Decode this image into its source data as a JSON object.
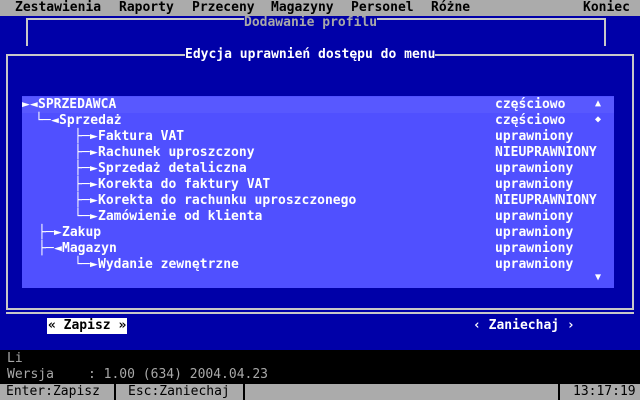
{
  "menubar": {
    "items": [
      "Zestawienia",
      "Raporty",
      "Przeceny",
      "Magazyny",
      "Personel",
      "Różne"
    ],
    "exit_label": "Koniec"
  },
  "dialog": {
    "title": "Dodawanie profilu",
    "section_title": "Edycja uprawnień dostępu do menu",
    "save_button": "« Zapisz »",
    "cancel_button": "‹ Zaniechaj ›"
  },
  "permissions": [
    {
      "label": "SPRZEDAWCA",
      "status": "częściowo"
    },
    {
      "label": "Sprzedaż",
      "status": "częściowo"
    },
    {
      "label": "Faktura VAT",
      "status": "uprawniony"
    },
    {
      "label": "Rachunek uproszczony",
      "status": "NIEUPRAWNIONY"
    },
    {
      "label": "Sprzedaż detaliczna",
      "status": "uprawniony"
    },
    {
      "label": "Korekta do faktury VAT",
      "status": "uprawniony"
    },
    {
      "label": "Korekta do rachunku uproszczonego",
      "status": "NIEUPRAWNIONY"
    },
    {
      "label": "Zamówienie od klienta",
      "status": "uprawniony"
    },
    {
      "label": "Zakup",
      "status": "uprawniony"
    },
    {
      "label": "Magazyn",
      "status": "uprawniony"
    },
    {
      "label": "Wydanie zewnętrzne",
      "status": "uprawniony"
    }
  ],
  "background": {
    "line1": "Li",
    "version_label": "Wersja",
    "version_value": ": 1.00 (634) 2004.04.23"
  },
  "statusbar": {
    "enter_hint": "Enter:Zapisz",
    "esc_hint": "Esc:Zaniechaj",
    "clock": "13:17:19"
  },
  "colors": {
    "dialog_bg": "#0000a8",
    "list_bg": "#5050ff",
    "bar_bg": "#ababab"
  }
}
